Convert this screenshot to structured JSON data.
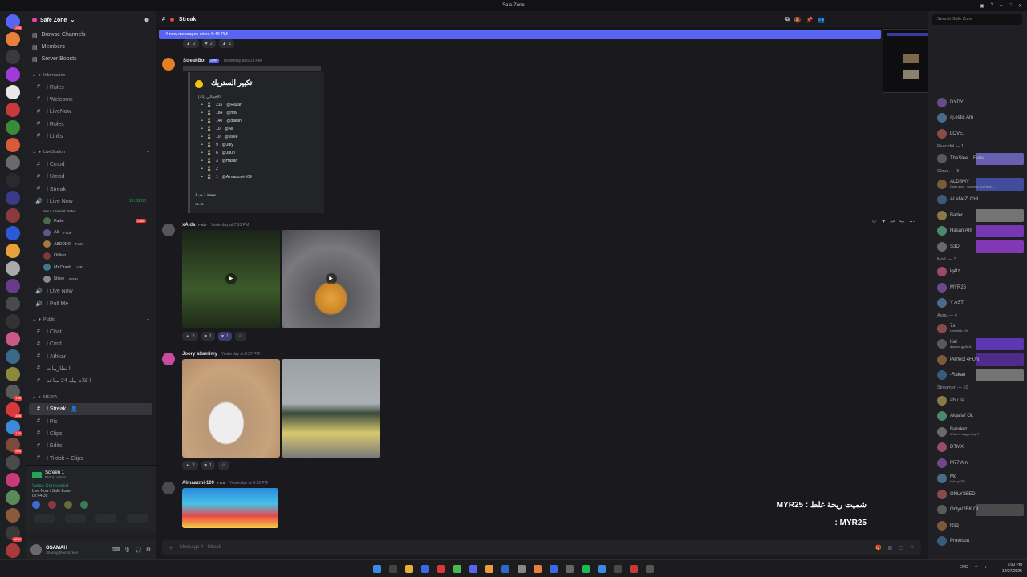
{
  "titlebar": {
    "title": "Safe Zone"
  },
  "server_badges": [
    "236",
    "136",
    "186",
    "125",
    "505",
    "NEW"
  ],
  "guild": {
    "name": "Safe Zone"
  },
  "nav": [
    {
      "label": "Browse Channels",
      "icon": "browse-icon"
    },
    {
      "label": "Members",
      "icon": "members-icon"
    },
    {
      "label": "Server Boosts",
      "icon": "boost-icon"
    }
  ],
  "categories": [
    {
      "name": "Information",
      "channels": [
        "Rules",
        "Welcome",
        "LiveNow",
        "Roles",
        "Links"
      ]
    },
    {
      "name": "LiveStation",
      "channels": [
        "Cmod",
        "Umod",
        "Streak"
      ]
    },
    {
      "name": "Public",
      "channels": [
        "Chat",
        "Cmd",
        "Athkar",
        "تطارييات",
        "كلام بيك 24 ساعه"
      ]
    },
    {
      "name": "MEDIA",
      "channels": [
        "Streak",
        "Pic",
        "Clips",
        "Edits",
        "Tiktok – Clips"
      ]
    }
  ],
  "voice": {
    "live_now": {
      "label": "Live Now",
      "time": "19:28:08",
      "status": "Set a channel status"
    },
    "users": [
      {
        "name": "Fade",
        "live": "LIVE"
      },
      {
        "name": "Ali",
        "tag": "Fade"
      },
      {
        "name": "A8D0D0",
        "tag": "Fade"
      },
      {
        "name": "Oillian"
      },
      {
        "name": "Mr.Crash",
        "tag": "VIP"
      },
      {
        "name": "5tilee",
        "tag": "BRIN"
      }
    ],
    "other": [
      "Live Now",
      "Pull Me"
    ]
  },
  "screen": {
    "label": "Screen 1",
    "sub": "BMOp ootms"
  },
  "voice_connected": {
    "label": "Voice Connected",
    "sub": "Live Now / Safe Zone",
    "time": "02:44:39"
  },
  "user": {
    "name": "OSAMAH",
    "status": "Sharing their screen"
  },
  "channel": {
    "name": "Streak"
  },
  "search": {
    "placeholder": "Search Safe Zone"
  },
  "new_messages": "4 new messages since 6:46 PM",
  "messages": [
    {
      "author": "StreakBot",
      "tag": "APP",
      "time": "Yesterday at 6:01 PM",
      "embed_title": "تكبير الستريك",
      "embed_sub": "الإجمالي (10)",
      "ranks": [
        {
          "n": "216",
          "u": "@Razan"
        },
        {
          "n": "184",
          "u": "@mtv"
        },
        {
          "n": "140",
          "u": "@daliah"
        },
        {
          "n": "10",
          "u": "@Ali"
        },
        {
          "n": "10",
          "u": "@5tilee"
        },
        {
          "n": "9",
          "u": "@July"
        },
        {
          "n": "6",
          "u": "@Juuri"
        },
        {
          "n": "3",
          "u": "@Hasan"
        },
        {
          "n": "2",
          "u": ""
        },
        {
          "n": "1",
          "u": "@Almaazmi-109"
        }
      ],
      "embed_footer": "صفحة 1 من 1",
      "embed_footer2": "v1.11"
    },
    {
      "author": "xAida",
      "tag": "Fade",
      "time": "Yesterday at 7:53 PM",
      "reactions": [
        "2",
        "1",
        "1"
      ]
    },
    {
      "author": "Joory altamimy",
      "time": "Yesterday at 8:37 PM",
      "reactions": [
        "2",
        "1"
      ]
    },
    {
      "author": "Almaazmi-109",
      "tag": "Fade",
      "time": "Yesterday at 8:39 PM"
    }
  ],
  "composer": {
    "placeholder": "Message # | Streak"
  },
  "overlay": {
    "line1": "شميت ريحة غلط : MYR25",
    "line2": "MYR25 :"
  },
  "members": [
    {
      "group": "",
      "items": [
        {
          "name": "DYDY",
          "color": "#6a8fd8"
        },
        {
          "name": "#j.estic",
          "tag": "Am"
        },
        {
          "name": "LOVE."
        }
      ]
    },
    {
      "group": "Peaceful — 1",
      "items": [
        {
          "name": "TheSlee...",
          "tag": "Fade",
          "hl": "#7b6fd6"
        }
      ]
    },
    {
      "group": "Cloud. — 5",
      "items": [
        {
          "name": "ALD8MY",
          "sub": "Don't stop , success isn't that ...",
          "hl": "#4a57b8"
        },
        {
          "name": "ALeNeZi",
          "tag": "CHL"
        },
        {
          "name": "Bader.",
          "hl": "#8a8a8a"
        },
        {
          "name": "Hasan",
          "tag": "Am",
          "hl": "#8b3fd6"
        },
        {
          "name": "S3D",
          "hl": "#9b3fd6"
        }
      ]
    },
    {
      "group": "Mod. — 3",
      "items": [
        {
          "name": "lq4lz"
        },
        {
          "name": "MYR25"
        },
        {
          "name": "Y",
          "tag": "AST"
        }
      ]
    },
    {
      "group": "Aura. — 4",
      "items": [
        {
          "name": "7s",
          "sub": "Live kick x7s"
        },
        {
          "name": "Kel",
          "sub": "discord.gg/MJU",
          "hl": "#6a3fd6"
        },
        {
          "name": "Perfect",
          "tag": "4FUN",
          "hl": "#5b2fa6"
        },
        {
          "name": "-Rakan",
          "hl": "#8a8a8a"
        }
      ]
    },
    {
      "group": "Streamer. — 10",
      "items": [
        {
          "name": "abu tia"
        },
        {
          "name": "Alqallaf",
          "tag": "OL"
        },
        {
          "name": "Banderr",
          "sub": "What is happening?!"
        },
        {
          "name": "DTMX"
        },
        {
          "name": "M77",
          "tag": "Am"
        },
        {
          "name": "Mo",
          "sub": "kick: yq33i"
        },
        {
          "name": "ONLY3BED"
        },
        {
          "name": "OnlyV2FK",
          "tag": "OL",
          "hl": "#555"
        },
        {
          "name": "Rsq"
        },
        {
          "name": "Protocoa"
        }
      ]
    }
  ],
  "taskbar": {
    "lang": "ENG",
    "time": "7:00 PM",
    "date": "12/27/2025"
  }
}
